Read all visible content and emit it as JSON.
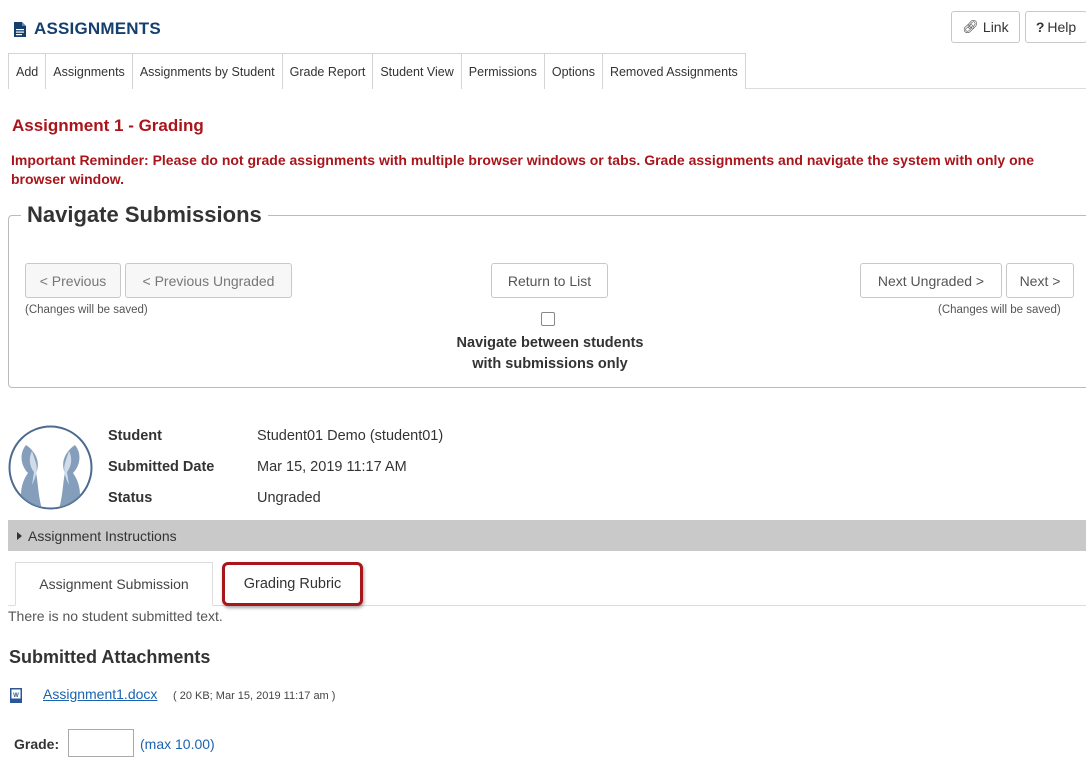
{
  "header": {
    "title": "ASSIGNMENTS",
    "link_label": "Link",
    "help_label": "Help"
  },
  "navbar": {
    "items": [
      {
        "label": "Add"
      },
      {
        "label": "Assignments"
      },
      {
        "label": "Assignments by Student"
      },
      {
        "label": "Grade Report"
      },
      {
        "label": "Student View"
      },
      {
        "label": "Permissions"
      },
      {
        "label": "Options"
      },
      {
        "label": "Removed Assignments"
      }
    ]
  },
  "page": {
    "title": "Assignment 1 - Grading",
    "reminder": "Important Reminder: Please do not grade assignments with multiple browser windows or tabs. Grade assignments and navigate the system with only one browser window."
  },
  "navigate": {
    "legend": "Navigate Submissions",
    "prev_label": "< Previous",
    "prev_ungraded_label": "< Previous Ungraded",
    "return_label": "Return to List",
    "next_ungraded_label": "Next Ungraded >",
    "next_label": "Next >",
    "changes_saved_left": "(Changes will be saved)",
    "changes_saved_right": "(Changes will be saved)",
    "only_submissions_line1": "Navigate between students",
    "only_submissions_line2": "with submissions only"
  },
  "student": {
    "student_label": "Student",
    "student_value": "Student01 Demo (student01)",
    "submitted_label": "Submitted Date",
    "submitted_value": "Mar 15, 2019 11:17 AM",
    "status_label": "Status",
    "status_value": "Ungraded"
  },
  "instructions": {
    "label": "Assignment Instructions"
  },
  "tabs": {
    "submission": "Assignment Submission",
    "rubric": "Grading Rubric"
  },
  "submission": {
    "no_text": "There is no student submitted text.",
    "attachments_heading": "Submitted Attachments",
    "attachment_name": "Assignment1.docx",
    "attachment_meta": "( 20 KB; Mar 15, 2019 11:17 am )"
  },
  "grade": {
    "label": "Grade:",
    "value": "",
    "max": "(max 10.00)"
  },
  "colors": {
    "title_blue": "#15406d",
    "alert_red": "#a9151b",
    "link_blue": "#1a63b0",
    "highlight_red": "#a8151a"
  }
}
